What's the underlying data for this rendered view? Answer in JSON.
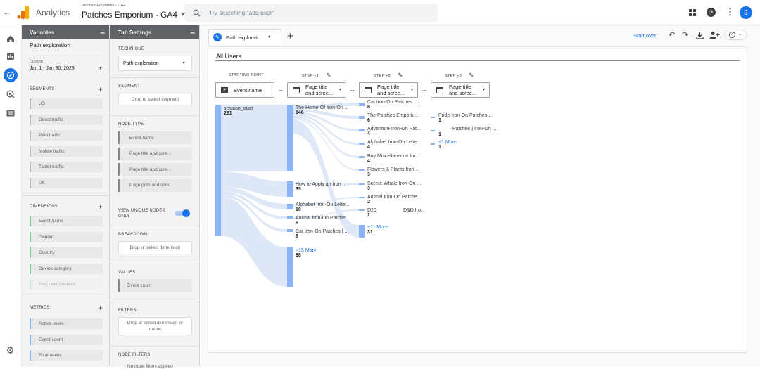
{
  "header": {
    "product": "Analytics",
    "account_small": "Patches Emporium - GA4",
    "property_title": "Patches Emporium - GA4",
    "search_placeholder": "Try searching \"add user\"",
    "avatar_letter": "J"
  },
  "colors": {
    "accent": "#1a73e8",
    "brand_orange": "#f9ab00",
    "node_bar": "#8ab4f8",
    "flow": "#dde6f6"
  },
  "variables": {
    "title": "Variables",
    "exploration_name": "Path exploration",
    "date_label": "Custom",
    "date_value": "Jan 1 - Jan 30, 2023",
    "segments_label": "SEGMENTS",
    "segments": [
      "US",
      "Direct traffic",
      "Paid traffic",
      "Mobile traffic",
      "Tablet traffic",
      "UK"
    ],
    "dimensions_label": "DIMENSIONS",
    "dimensions": [
      "Event name",
      "Gender",
      "Country",
      "Device category",
      "First user medium"
    ],
    "metrics_label": "METRICS",
    "metrics": [
      "Active users",
      "Event count",
      "Total users"
    ]
  },
  "tab_settings": {
    "title": "Tab Settings",
    "technique_label": "TECHNIQUE",
    "technique_value": "Path exploration",
    "segment_label": "SEGMENT",
    "segment_drop": "Drop or select segment",
    "node_type_label": "NODE TYPE",
    "node_types": [
      "Event name",
      "Page title and scre...",
      "Page title and scre...",
      "Page path and scre..."
    ],
    "view_unique": "VIEW UNIQUE NODES ONLY",
    "breakdown_label": "BREAKDOWN",
    "breakdown_drop": "Drop or select dimension",
    "values_label": "VALUES",
    "values_item": "Event count",
    "filters_label": "FILTERS",
    "filters_drop": "Drop or select dimension or metric",
    "node_filters_label": "NODE FILTERS",
    "node_filters_text": "No node filters applied"
  },
  "toolbar": {
    "tab_label": "Path explorati...",
    "start_over": "Start over"
  },
  "exploration": {
    "segment_title": "All Users",
    "steps": {
      "start_header": "STARTING POINT",
      "step1_header": "STEP +1",
      "step2_header": "STEP +2",
      "step3_header": "STEP +3",
      "start_select": "Event name",
      "step_select_l1": "Page title",
      "step_select_l2": "and scree..."
    },
    "start_node": {
      "label": "session_start",
      "value": "291"
    },
    "step1": [
      {
        "label": "The Home Of Iron-On ...",
        "value": "146"
      },
      {
        "label": "How to Apply an Iron ...",
        "value": "35"
      },
      {
        "label": "Alphabet Iron-On Lette...",
        "value": "10"
      },
      {
        "label": "Animal Iron-On Patche...",
        "value": "6"
      },
      {
        "label": "Cat Iron-On Patches | ...",
        "value": "6"
      }
    ],
    "step1_more": {
      "label": "+15 More",
      "value": "88"
    },
    "step2": [
      {
        "label": "Cat Iron-On Patches | ...",
        "value": "8"
      },
      {
        "label": "The Patches Emporiu...",
        "value": "6"
      },
      {
        "label": "Adventure Iron-On Pat...",
        "value": "4"
      },
      {
        "label": "Alphabet Iron-On Lette...",
        "value": "4"
      },
      {
        "label": "Buy Miscellaneous Iro...",
        "value": "4"
      },
      {
        "label": "Flowers & Plants Iron ...",
        "value": "3"
      },
      {
        "label": "Scenic Whale Iron-On ...",
        "value": "3"
      },
      {
        "label": "Animal Iron-On Patche...",
        "value": "2"
      },
      {
        "label": "D20",
        "value": "2"
      }
    ],
    "step2_extra_label": "D&D Iro...",
    "step2_more": {
      "label": "+11 More",
      "value": "31"
    },
    "step3": [
      {
        "label": "Pride Iron-On Patches ...",
        "value": "1"
      },
      {
        "label": "",
        "value": "1"
      }
    ],
    "step3_extra_label": "Patches | Iron-On ...",
    "step3_more": {
      "label": "+1 More",
      "value": "1"
    }
  }
}
